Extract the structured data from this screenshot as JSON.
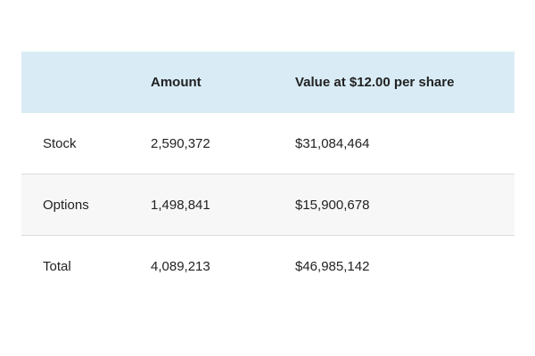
{
  "table": {
    "headers": [
      "",
      "Amount",
      "Value at $12.00 per share"
    ],
    "rows": [
      {
        "label": "Stock",
        "amount": "2,590,372",
        "value": "$31,084,464"
      },
      {
        "label": "Options",
        "amount": "1,498,841",
        "value": "$15,900,678"
      },
      {
        "label": "Total",
        "amount": "4,089,213",
        "value": "$46,985,142"
      }
    ]
  },
  "colors": {
    "header_background": "#d9ecf6",
    "striped_row_background": "#f7f7f7",
    "row_divider": "#dcdcdc"
  }
}
